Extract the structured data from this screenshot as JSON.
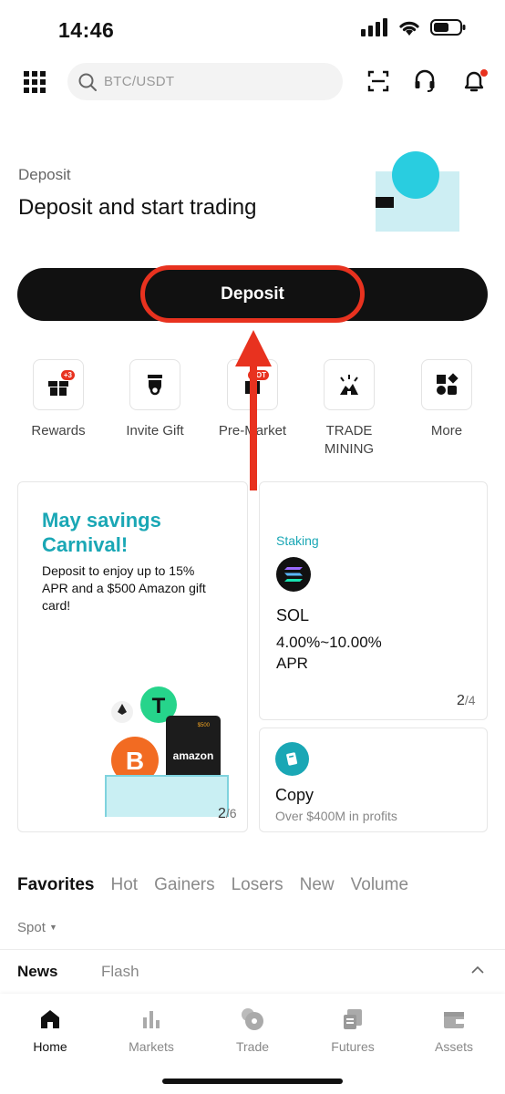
{
  "status": {
    "time": "14:46"
  },
  "search": {
    "placeholder": "BTC/USDT"
  },
  "deposit": {
    "subtitle": "Deposit",
    "title": "Deposit and start trading",
    "button_label": "Deposit"
  },
  "quick_actions": [
    {
      "label": "Rewards",
      "icon": "gift-box-icon",
      "badge": "+3"
    },
    {
      "label": "Invite Gift",
      "icon": "invite-gift-icon"
    },
    {
      "label": "Pre-Market",
      "icon": "pre-market-icon",
      "badge": "HOT"
    },
    {
      "label": "TRADE MINING",
      "icon": "trade-mining-icon"
    },
    {
      "label": "More",
      "icon": "more-grid-icon"
    }
  ],
  "promo": {
    "title_line1": "May savings",
    "title_line2": "Carnival!",
    "description": "Deposit to enjoy up to 15% APR and a $500 Amazon gift card!",
    "gift_card_brand": "amazon",
    "gift_card_value": "$500",
    "page_current": "2",
    "page_total": "/6"
  },
  "staking": {
    "tag": "Staking",
    "coin": "SOL",
    "apr_range": "4.00%~10.00%",
    "apr_label": "APR",
    "page_current": "2",
    "page_total": "/4"
  },
  "copy": {
    "title": "Copy",
    "subtitle": "Over $400M in profits"
  },
  "market_tabs": [
    "Favorites",
    "Hot",
    "Gainers",
    "Losers",
    "New",
    "Volume"
  ],
  "spot_filter": {
    "label": "Spot"
  },
  "news": {
    "tab_active": "News",
    "tab_other": "Flash"
  },
  "bottom_nav": [
    {
      "label": "Home",
      "icon": "home-icon"
    },
    {
      "label": "Markets",
      "icon": "markets-icon"
    },
    {
      "label": "Trade",
      "icon": "trade-icon"
    },
    {
      "label": "Futures",
      "icon": "futures-icon"
    },
    {
      "label": "Assets",
      "icon": "assets-icon"
    }
  ],
  "colors": {
    "accent_teal": "#1aa7b5",
    "highlight_red": "#e8321f",
    "primary_button": "#111111"
  }
}
